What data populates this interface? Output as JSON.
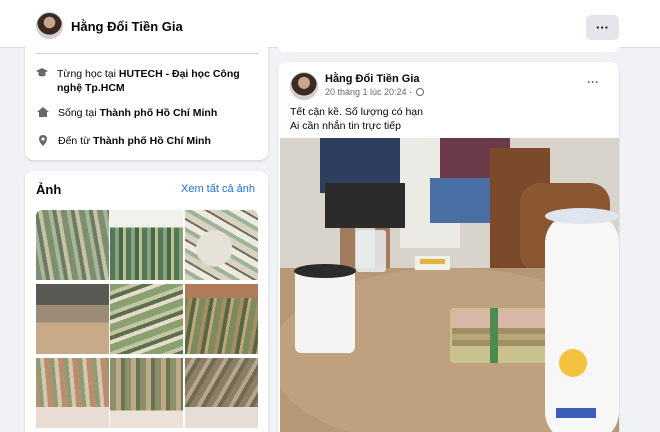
{
  "header": {
    "profile_name": "Hằng Đổi Tiền Gia",
    "more_label": "···"
  },
  "intro": {
    "items": [
      {
        "icon": "graduation-cap-icon",
        "prefix": "Từng học tại ",
        "bold": "HUTECH - Đại học Công nghệ Tp.HCM"
      },
      {
        "icon": "home-icon",
        "prefix": "Sống tại ",
        "bold": "Thành phố Hồ Chí Minh"
      },
      {
        "icon": "location-pin-icon",
        "prefix": "Đến từ ",
        "bold": "Thành phố Hồ Chí Minh"
      }
    ]
  },
  "photos": {
    "title": "Ảnh",
    "see_all": "Xem tất cả ảnh"
  },
  "post": {
    "author": "Hằng Đổi Tiền Gia",
    "timestamp": "20 tháng 1 lúc 20:24 ·",
    "more_label": "···",
    "line1": "Tết cận kề. Số lượng có hạn",
    "line2": "Ai cần nhắn tin trực tiếp"
  },
  "colors": {
    "link": "#216fdb",
    "background": "#f0f2f5",
    "card": "#ffffff"
  }
}
